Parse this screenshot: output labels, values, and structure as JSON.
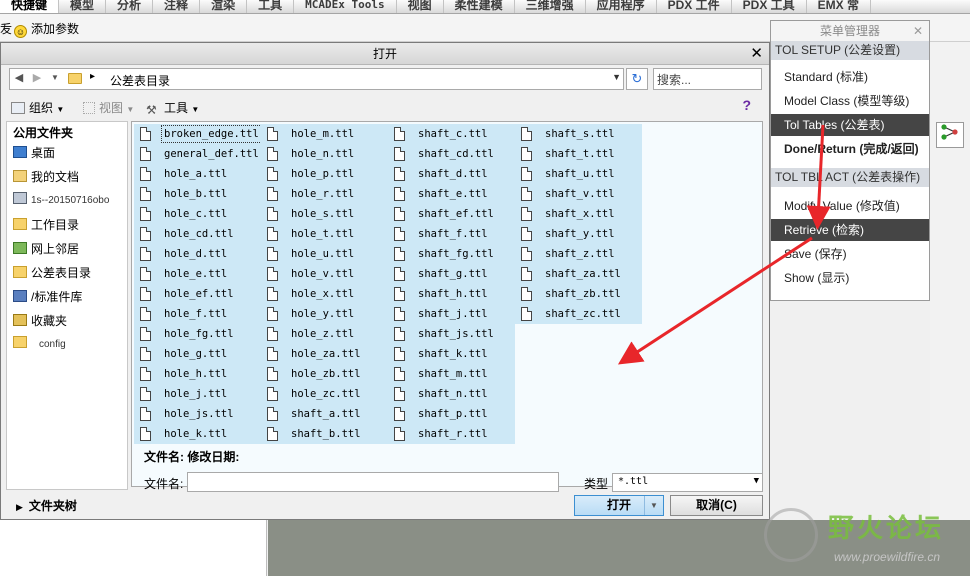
{
  "ribbon": {
    "tabs": [
      "快捷键",
      "模型",
      "分析",
      "注释",
      "渲染",
      "工具",
      "MCADEx Tools",
      "视图",
      "柔性建模",
      "三维增强",
      "应用程序",
      "PDX 工件",
      "PDX 工具",
      "EMX 常"
    ]
  },
  "toolbar": {
    "add_param": "添加参数",
    "left_char": "叐"
  },
  "dialog": {
    "title": "打开",
    "path": "公差表目录",
    "search_placeholder": "搜索...",
    "tools": {
      "organize": "组织",
      "view": "视图",
      "tools": "工具"
    },
    "left_pane": {
      "header": "公用文件夹",
      "items": [
        "桌面",
        "我的文档",
        "1s--20150716obo",
        "工作目录",
        "网上邻居",
        "公差表目录",
        "/标准件库",
        "收藏夹",
        "config"
      ]
    },
    "tree_label": "文件夹树",
    "files": [
      [
        "broken_edge.ttl",
        "general_def.ttl",
        "hole_a.ttl",
        "hole_b.ttl",
        "hole_c.ttl",
        "hole_cd.ttl",
        "hole_d.ttl",
        "hole_e.ttl",
        "hole_ef.ttl",
        "hole_f.ttl",
        "hole_fg.ttl",
        "hole_g.ttl",
        "hole_h.ttl",
        "hole_j.ttl",
        "hole_js.ttl",
        "hole_k.ttl"
      ],
      [
        "hole_m.ttl",
        "hole_n.ttl",
        "hole_p.ttl",
        "hole_r.ttl",
        "hole_s.ttl",
        "hole_t.ttl",
        "hole_u.ttl",
        "hole_v.ttl",
        "hole_x.ttl",
        "hole_y.ttl",
        "hole_z.ttl",
        "hole_za.ttl",
        "hole_zb.ttl",
        "hole_zc.ttl",
        "shaft_a.ttl",
        "shaft_b.ttl"
      ],
      [
        "shaft_c.ttl",
        "shaft_cd.ttl",
        "shaft_d.ttl",
        "shaft_e.ttl",
        "shaft_ef.ttl",
        "shaft_f.ttl",
        "shaft_fg.ttl",
        "shaft_g.ttl",
        "shaft_h.ttl",
        "shaft_j.ttl",
        "shaft_js.ttl",
        "shaft_k.ttl",
        "shaft_m.ttl",
        "shaft_n.ttl",
        "shaft_p.ttl",
        "shaft_r.ttl"
      ],
      [
        "shaft_s.ttl",
        "shaft_t.ttl",
        "shaft_u.ttl",
        "shaft_v.ttl",
        "shaft_x.ttl",
        "shaft_y.ttl",
        "shaft_z.ttl",
        "shaft_za.ttl",
        "shaft_zb.ttl",
        "shaft_zc.ttl"
      ]
    ],
    "info_row": "文件名:  修改日期:",
    "filename_label": "文件名:",
    "filename_value": "",
    "type_label": "类型",
    "type_value": "*.ttl",
    "open_label": "打开",
    "cancel_label": "取消(C)"
  },
  "menu_manager": {
    "title": "菜单管理器",
    "section1": "TOL SETUP (公差设置)",
    "items1": [
      "Standard (标准)",
      "Model Class (模型等级)",
      "Tol Tables (公差表)",
      "Done/Return (完成/返回)"
    ],
    "section2": "TOL TBL ACT (公差表操作)",
    "items2": [
      "Modify Value (修改值)",
      "Retrieve (检索)",
      "Save (保存)",
      "Show (显示)"
    ]
  },
  "watermark": {
    "title": "野火论坛",
    "url": "www.proewildfire.cn"
  },
  "colors": {
    "selection": "#cde8f6",
    "menu_selected": "#454545",
    "arrow": "#e8262a",
    "open_button": "#b9dcf5"
  }
}
